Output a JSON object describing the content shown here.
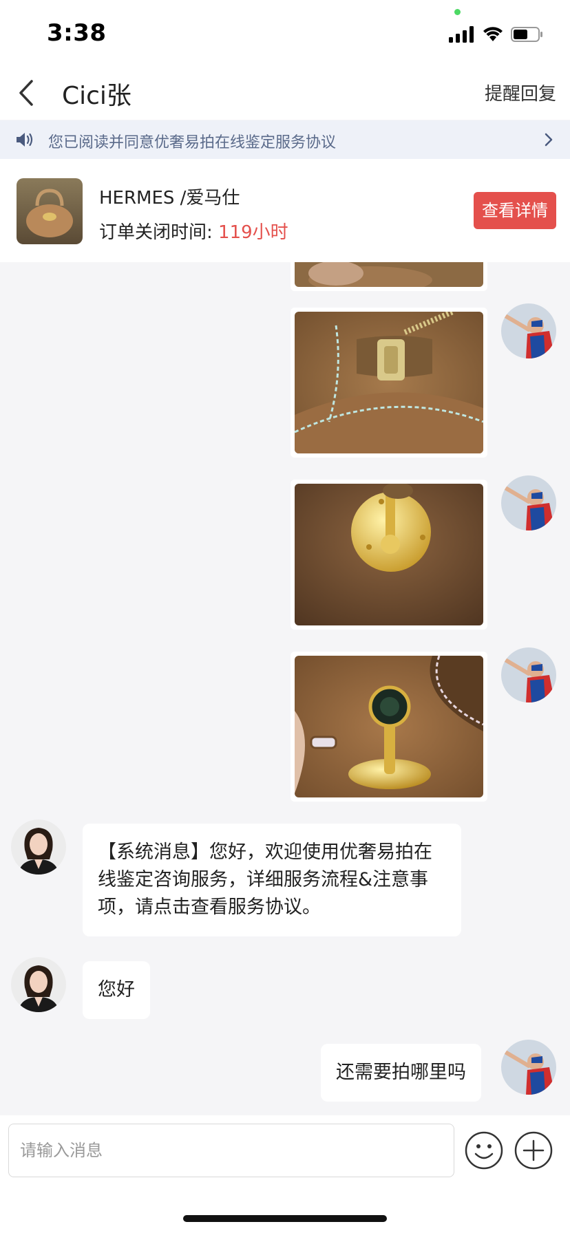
{
  "status_bar": {
    "time": "3:38"
  },
  "nav": {
    "title": "Cici张",
    "right_action": "提醒回复"
  },
  "notice": {
    "text": "您已阅读并同意优奢易拍在线鉴定服务协议"
  },
  "order": {
    "product_name": "HERMES /爱马仕",
    "close_time_label": "订单关闭时间: ",
    "close_time_value": "119小时",
    "detail_button": "查看详情"
  },
  "messages": [
    {
      "side": "left",
      "sender": "service-agent",
      "text": "【系统消息】您好，欢迎使用优奢易拍在线鉴定咨询服务，详细服务流程&注意事项，请点击查看服务协议。"
    },
    {
      "side": "left",
      "sender": "service-agent",
      "text": "您好"
    },
    {
      "side": "right",
      "sender": "user",
      "text": "还需要拍哪里吗"
    }
  ],
  "photo_messages": [
    {
      "side": "right",
      "icon": "bag-zipper-photo"
    },
    {
      "side": "right",
      "icon": "bag-clasp-plate-photo"
    },
    {
      "side": "right",
      "icon": "bag-hermes-paris-stud-photo"
    }
  ],
  "input": {
    "placeholder": "请输入消息"
  },
  "colors": {
    "accent_red": "#e4504c",
    "notice_bg": "#eef1f8",
    "chat_bg": "#f5f5f7"
  }
}
